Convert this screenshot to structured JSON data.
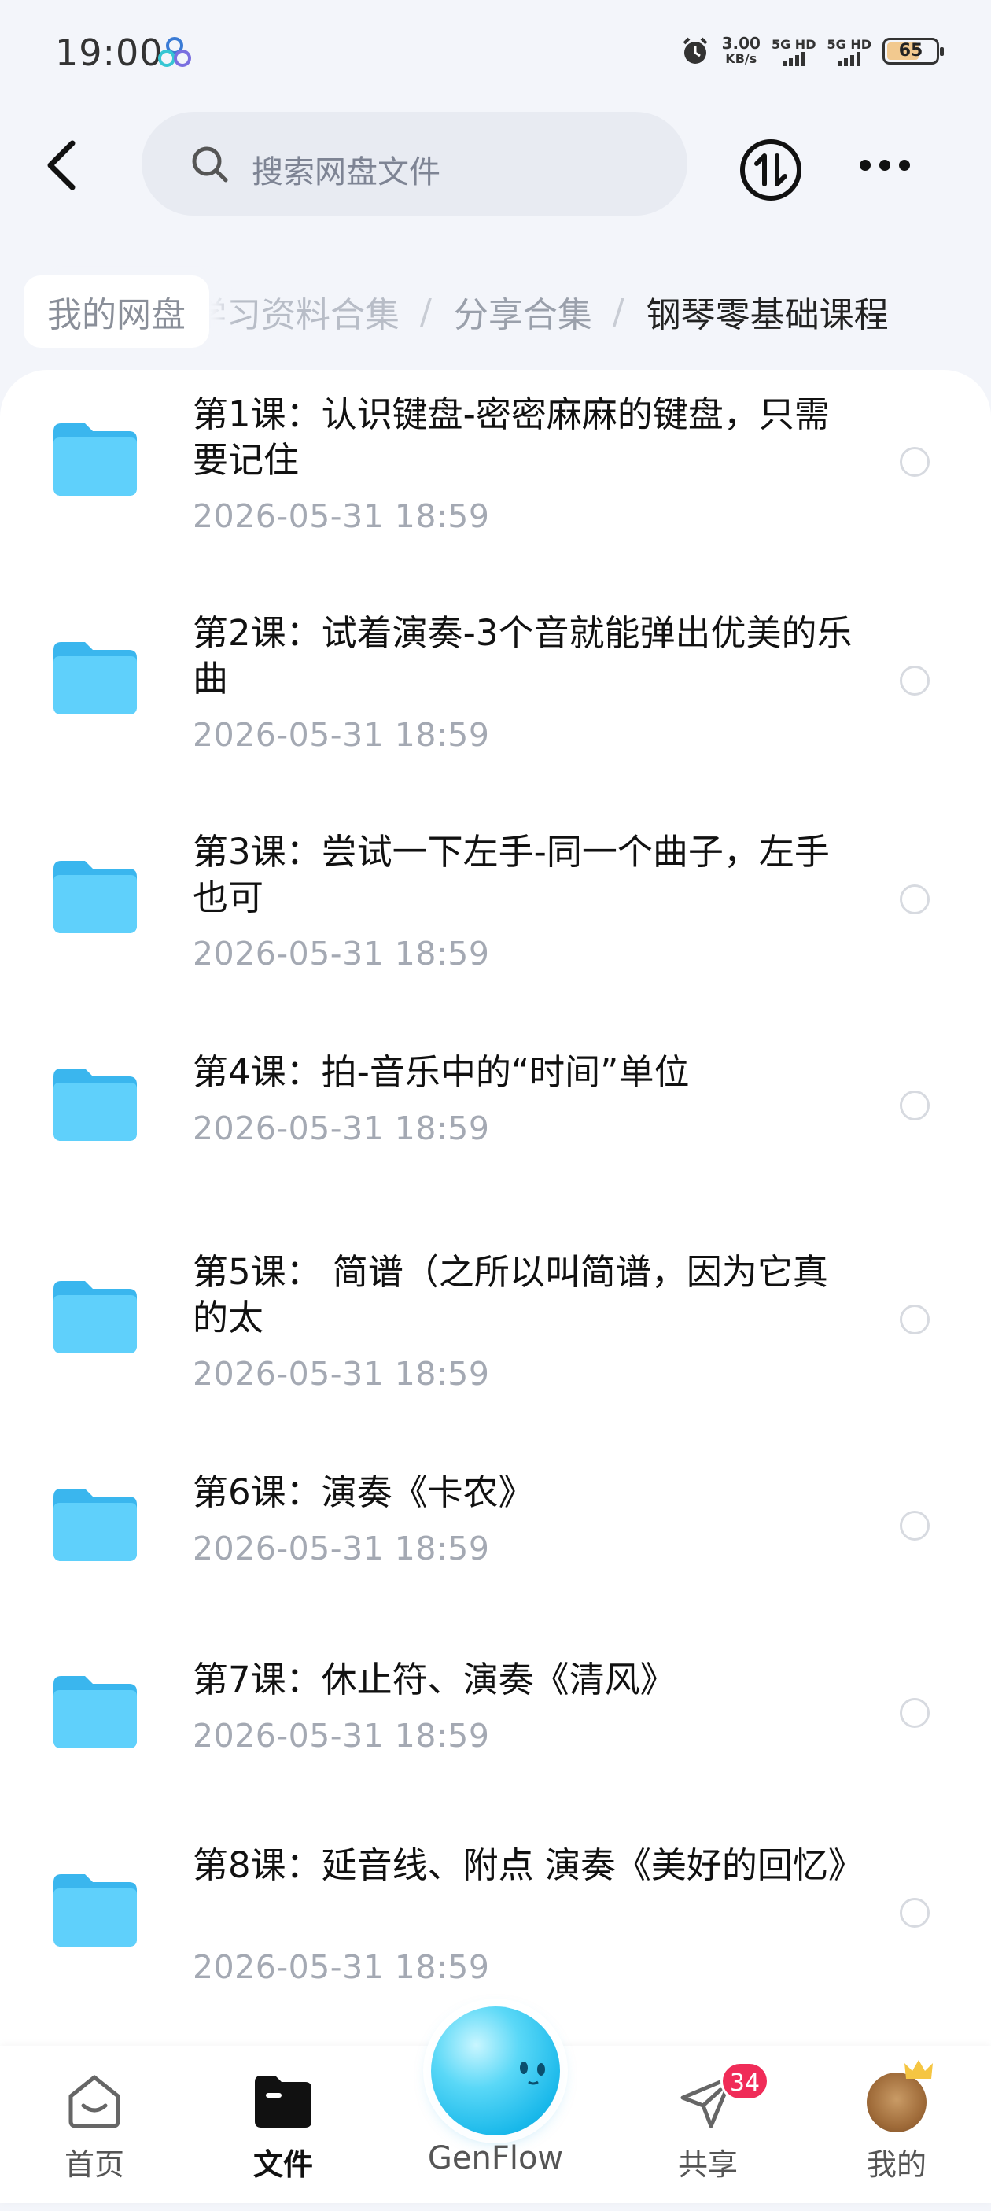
{
  "status_bar": {
    "time": "19:00",
    "net_speed": "3.00",
    "net_speed_unit": "KB/s",
    "sim1": "5G HD",
    "sim2": "5G HD",
    "battery": "65"
  },
  "header": {
    "search_placeholder": "搜索网盘文件",
    "icons": [
      "back-arrow-icon",
      "search-icon",
      "transfer-icon",
      "more-icon"
    ]
  },
  "breadcrumb": {
    "home": "我的网盘",
    "items": [
      "学习资料合集",
      "分享合集",
      "钢琴零基础课程"
    ],
    "separator": "/"
  },
  "files": [
    {
      "title": "第1课：认识键盘-密密麻麻的键盘，只需要记住",
      "date": "2026-05-31  18:59"
    },
    {
      "title": "第2课：试着演奏-3个音就能弹出优美的乐曲",
      "date": "2026-05-31  18:59"
    },
    {
      "title": "第3课：尝试一下左手-同一个曲子，左手也可",
      "date": "2026-05-31  18:59"
    },
    {
      "title": "第4课：拍-音乐中的“时间”单位",
      "date": "2026-05-31  18:59"
    },
    {
      "title": "第5课： 简谱（之所以叫简谱，因为它真的太",
      "date": "2026-05-31  18:59"
    },
    {
      "title": "第6课：演奏《卡农》",
      "date": "2026-05-31  18:59"
    },
    {
      "title": "第7课：休止符、演奏《清风》",
      "date": "2026-05-31  18:59"
    },
    {
      "title": "第8课：延音线、附点 演奏《美好的回忆》",
      "date": "2026-05-31  18:59"
    }
  ],
  "bottom_nav": {
    "home": "首页",
    "files": "文件",
    "genflow": "GenFlow",
    "share": "共享",
    "share_badge": "34",
    "me": "我的"
  },
  "colors": {
    "folder": "#4fc3f7",
    "badge": "#f02c58",
    "background": "#f3f5fa"
  }
}
